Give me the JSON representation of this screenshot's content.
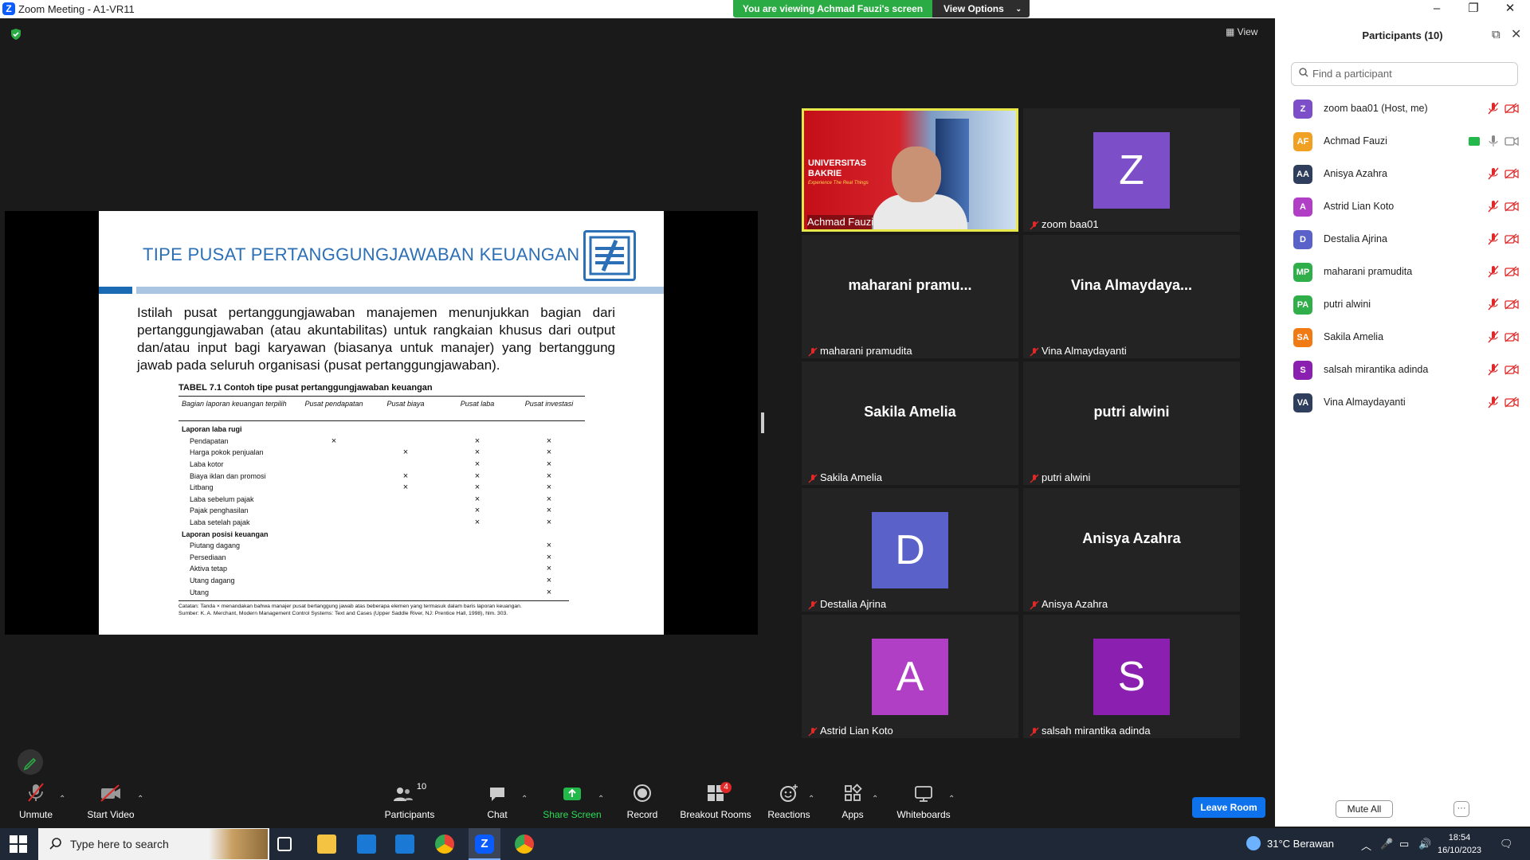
{
  "window": {
    "title": "Zoom Meeting - A1-VR11",
    "app_icon": "Z"
  },
  "banner": {
    "viewing": "You are viewing Achmad Fauzi's screen",
    "view_options": "View Options"
  },
  "view_button": "View",
  "slide": {
    "title": "TIPE PUSAT PERTANGGUNGJAWABAN KEUANGAN",
    "paragraph": "Istilah pusat pertanggungjawaban manajemen menunjukkan bagian dari pertanggungjawaban (atau akuntabilitas) untuk rangkaian khusus dari output dan/atau input bagi karyawan (biasanya untuk manajer) yang bertanggung jawab pada seluruh organisasi (pusat pertanggungjawaban).",
    "table_caption": "TABEL 7.1 Contoh tipe pusat pertanggungjawaban keuangan",
    "headers": [
      "Bagian laporan keuangan terpilih",
      "Pusat pendapatan",
      "Pusat biaya",
      "Pusat laba",
      "Pusat investasi"
    ],
    "sections": [
      {
        "title": "Laporan laba rugi",
        "rows": [
          {
            "label": "Pendapatan",
            "marks": [
              "×",
              "",
              "×",
              "×"
            ]
          },
          {
            "label": "Harga pokok penjualan",
            "marks": [
              "",
              "×",
              "×",
              "×"
            ]
          },
          {
            "label": "Laba kotor",
            "marks": [
              "",
              "",
              "×",
              "×"
            ]
          },
          {
            "label": "Biaya iklan dan promosi",
            "marks": [
              "",
              "×",
              "×",
              "×"
            ]
          },
          {
            "label": "Litbang",
            "marks": [
              "",
              "×",
              "×",
              "×"
            ]
          },
          {
            "label": "Laba sebelum pajak",
            "marks": [
              "",
              "",
              "×",
              "×"
            ]
          },
          {
            "label": "Pajak penghasilan",
            "marks": [
              "",
              "",
              "×",
              "×"
            ]
          },
          {
            "label": "Laba setelah pajak",
            "marks": [
              "",
              "",
              "×",
              "×"
            ]
          }
        ]
      },
      {
        "title": "Laporan posisi keuangan",
        "rows": [
          {
            "label": "Piutang dagang",
            "marks": [
              "",
              "",
              "",
              "×"
            ]
          },
          {
            "label": "Persediaan",
            "marks": [
              "",
              "",
              "",
              "×"
            ]
          },
          {
            "label": "Aktiva tetap",
            "marks": [
              "",
              "",
              "",
              "×"
            ]
          },
          {
            "label": "Utang dagang",
            "marks": [
              "",
              "",
              "",
              "×"
            ]
          },
          {
            "label": "Utang",
            "marks": [
              "",
              "",
              "",
              "×"
            ]
          }
        ]
      }
    ],
    "note1": "Catatan: Tanda × menandakan bahwa manajer pusat bertanggung jawab atas beberapa elemen yang termasuk dalam baris laporan keuangan.",
    "note2": "Sumber: K. A. Merchant, Modern Management Control Systems: Text and Cases (Upper Saddle River, NJ: Prentice Hall, 1998), hlm. 303."
  },
  "video_tiles": [
    {
      "center": "",
      "label": "Achmad Fauzi",
      "type": "camera"
    },
    {
      "center": "Z",
      "label": "zoom baa01",
      "type": "avatar",
      "color": "#7c4fc9"
    },
    {
      "center": "maharani pramu...",
      "label": "maharani pramudita",
      "type": "name"
    },
    {
      "center": "Vina Almaydaya...",
      "label": "Vina Almaydayanti",
      "type": "name"
    },
    {
      "center": "Sakila Amelia",
      "label": "Sakila Amelia",
      "type": "name"
    },
    {
      "center": "putri alwini",
      "label": "putri alwini",
      "type": "name"
    },
    {
      "center": "D",
      "label": "Destalia Ajrina",
      "type": "avatar",
      "color": "#5a61c9"
    },
    {
      "center": "Anisya Azahra",
      "label": "Anisya Azahra",
      "type": "name"
    },
    {
      "center": "A",
      "label": "Astrid Lian Koto",
      "type": "avatar",
      "color": "#b03fc6"
    },
    {
      "center": "S",
      "label": "salsah mirantika adinda",
      "type": "avatar",
      "color": "#8b1fb0"
    }
  ],
  "camera": {
    "university": "UNIVERSITAS BAKRIE",
    "tagline": "Experience The Real Things"
  },
  "toolbar": {
    "unmute": "Unmute",
    "start_video": "Start Video",
    "participants": "Participants",
    "participants_count": "10",
    "chat": "Chat",
    "share": "Share Screen",
    "record": "Record",
    "breakout": "Breakout Rooms",
    "breakout_badge": "4",
    "reactions": "Reactions",
    "apps": "Apps",
    "whiteboards": "Whiteboards",
    "leave": "Leave Room"
  },
  "panel": {
    "title": "Participants (10)",
    "search_placeholder": "Find a participant",
    "mute_all": "Mute All",
    "more": "···",
    "participants": [
      {
        "initials": "Z",
        "name": "zoom baa01 (Host, me)",
        "color": "#7c4fc9",
        "muted": true,
        "video_off": true
      },
      {
        "initials": "AF",
        "name": "Achmad Fauzi",
        "color": "#f0a023",
        "muted": false,
        "video_off": false,
        "sharing": true
      },
      {
        "initials": "AA",
        "name": "Anisya Azahra",
        "color": "#2f3e5c",
        "muted": true,
        "video_off": true
      },
      {
        "initials": "A",
        "name": "Astrid Lian Koto",
        "color": "#b03fc6",
        "muted": true,
        "video_off": true
      },
      {
        "initials": "D",
        "name": "Destalia Ajrina",
        "color": "#5a61c9",
        "muted": true,
        "video_off": true
      },
      {
        "initials": "MP",
        "name": "maharani pramudita",
        "color": "#2fae4a",
        "muted": true,
        "video_off": true
      },
      {
        "initials": "PA",
        "name": "putri alwini",
        "color": "#2fae4a",
        "muted": true,
        "video_off": true
      },
      {
        "initials": "SA",
        "name": "Sakila Amelia",
        "color": "#f07a14",
        "muted": true,
        "video_off": true
      },
      {
        "initials": "S",
        "name": "salsah mirantika adinda",
        "color": "#8b1fb0",
        "muted": true,
        "video_off": true
      },
      {
        "initials": "VA",
        "name": "Vina Almaydayanti",
        "color": "#2f3e5c",
        "muted": true,
        "video_off": true
      }
    ]
  },
  "taskbar": {
    "search_placeholder": "Type here to search",
    "weather": "31°C  Berawan",
    "time": "18:54",
    "date": "16/10/2023"
  }
}
